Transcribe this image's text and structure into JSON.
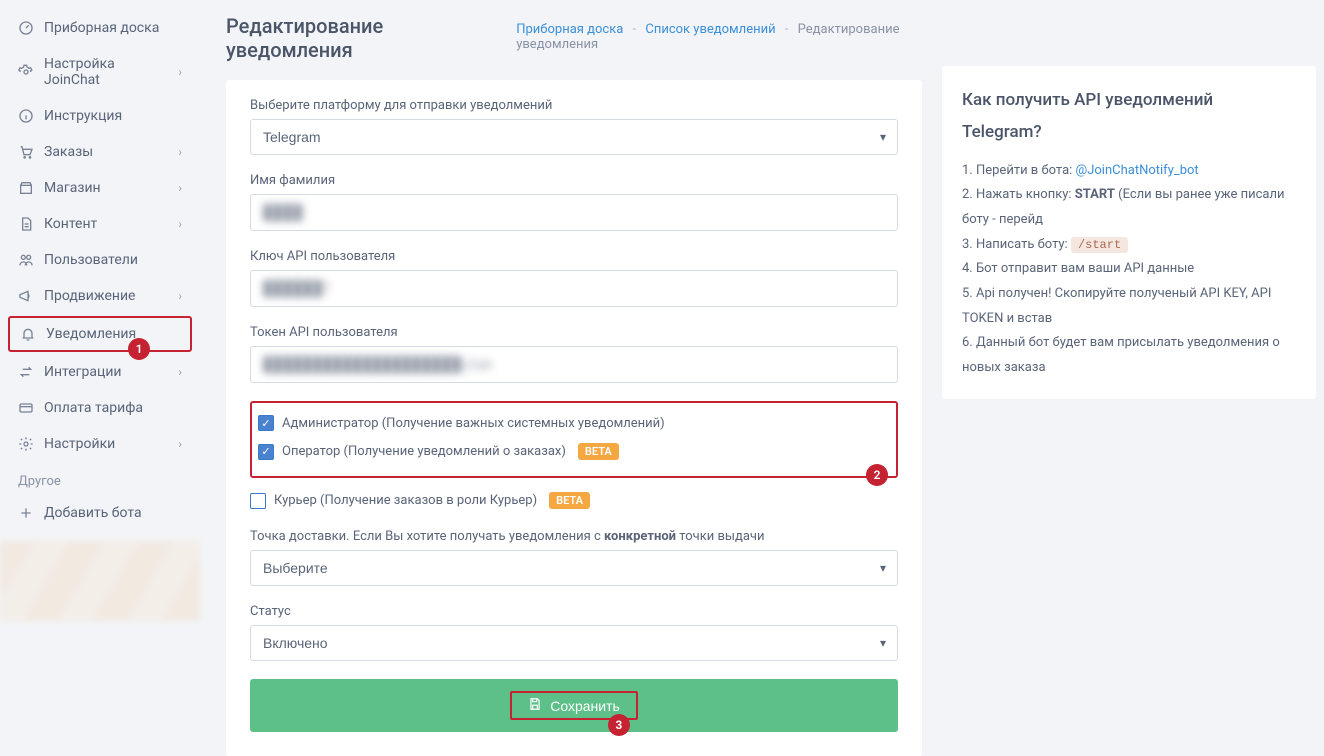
{
  "sidebar": {
    "items": [
      {
        "icon": "gauge",
        "label": "Приборная доска",
        "chevron": false
      },
      {
        "icon": "gear",
        "label": "Настройка JoinChat",
        "chevron": true
      },
      {
        "icon": "info",
        "label": "Инструкция",
        "chevron": false
      },
      {
        "icon": "cart",
        "label": "Заказы",
        "chevron": true
      },
      {
        "icon": "store",
        "label": "Магазин",
        "chevron": true
      },
      {
        "icon": "doc",
        "label": "Контент",
        "chevron": true
      },
      {
        "icon": "users",
        "label": "Пользователи",
        "chevron": false
      },
      {
        "icon": "promo",
        "label": "Продвижение",
        "chevron": true
      },
      {
        "icon": "bell",
        "label": "Уведомления",
        "chevron": false,
        "highlight": true
      },
      {
        "icon": "swap",
        "label": "Интеграции",
        "chevron": true
      },
      {
        "icon": "card",
        "label": "Оплата тарифа",
        "chevron": false
      },
      {
        "icon": "gear",
        "label": "Настройки",
        "chevron": true
      }
    ],
    "other_label": "Другое",
    "add_bot": "Добавить бота"
  },
  "header": {
    "title": "Редактирование уведомления",
    "crumbs": {
      "a": "Приборная доска",
      "b": "Список уведомлений",
      "c": "Редактирование уведомления"
    }
  },
  "form": {
    "platform_label": "Выберите платформу для отправки уведолмений",
    "platform_value": "Telegram",
    "name_label": "Имя фамилия",
    "name_value": "████",
    "apikey_label": "Ключ API пользователя",
    "apikey_value": "██████7",
    "token_label": "Токен API пользователя",
    "token_value": "████████████████████c2ab",
    "chk_admin": "Администратор (Получение важных системных уведомлений)",
    "chk_operator": "Оператор (Получение уведомлений о заказах)",
    "chk_courier": "Курьер (Получение заказов в роли Курьер)",
    "beta": "BETA",
    "delivery_label_pre": "Точка доставки. Если Вы хотите получать уведомления с ",
    "delivery_label_bold": "конкретной",
    "delivery_label_post": " точки выдачи",
    "delivery_value": "Выберите",
    "status_label": "Статус",
    "status_value": "Включено",
    "save": "Сохранить"
  },
  "help": {
    "title": "Как получить API уведолмений Telegram?",
    "s1": "1. Перейти в бота: ",
    "s1_link": "@JoinChatNotify_bot",
    "s2a": "2. Нажать кнопку: ",
    "s2b": "START",
    "s2c": " (Если вы ранее уже писали боту - перейд",
    "s3a": "3. Написать боту: ",
    "s3code": "/start",
    "s4": "4. Бот отправит вам ваши API данные",
    "s5": "5. Api получен! Скопируйте полученый API KEY, API TOKEN и встав",
    "s6": "6. Данный бот будет вам присылать уведолмения о новых заказа"
  },
  "markers": {
    "m1": "1",
    "m2": "2",
    "m3": "3"
  }
}
